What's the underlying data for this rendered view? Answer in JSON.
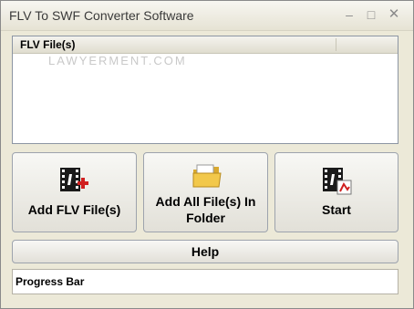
{
  "window": {
    "title": "FLV To SWF Converter Software",
    "controls": {
      "minimize": "–",
      "maximize": "□",
      "close": "✕"
    }
  },
  "file_list": {
    "column_header": "FLV File(s)",
    "watermark": "LAWYERMENT.COM",
    "rows": []
  },
  "buttons": {
    "add_flv": {
      "label": "Add FLV File(s)",
      "icon": "film-add-icon"
    },
    "add_all": {
      "label": "Add All File(s) In Folder",
      "icon": "folder-icon"
    },
    "start": {
      "label": "Start",
      "icon": "film-convert-icon"
    },
    "help": {
      "label": "Help"
    }
  },
  "progress": {
    "label": "Progress Bar"
  },
  "colors": {
    "window_bg": "#ece9d8",
    "icon_red": "#d02020",
    "folder_yellow": "#f2c84b"
  }
}
